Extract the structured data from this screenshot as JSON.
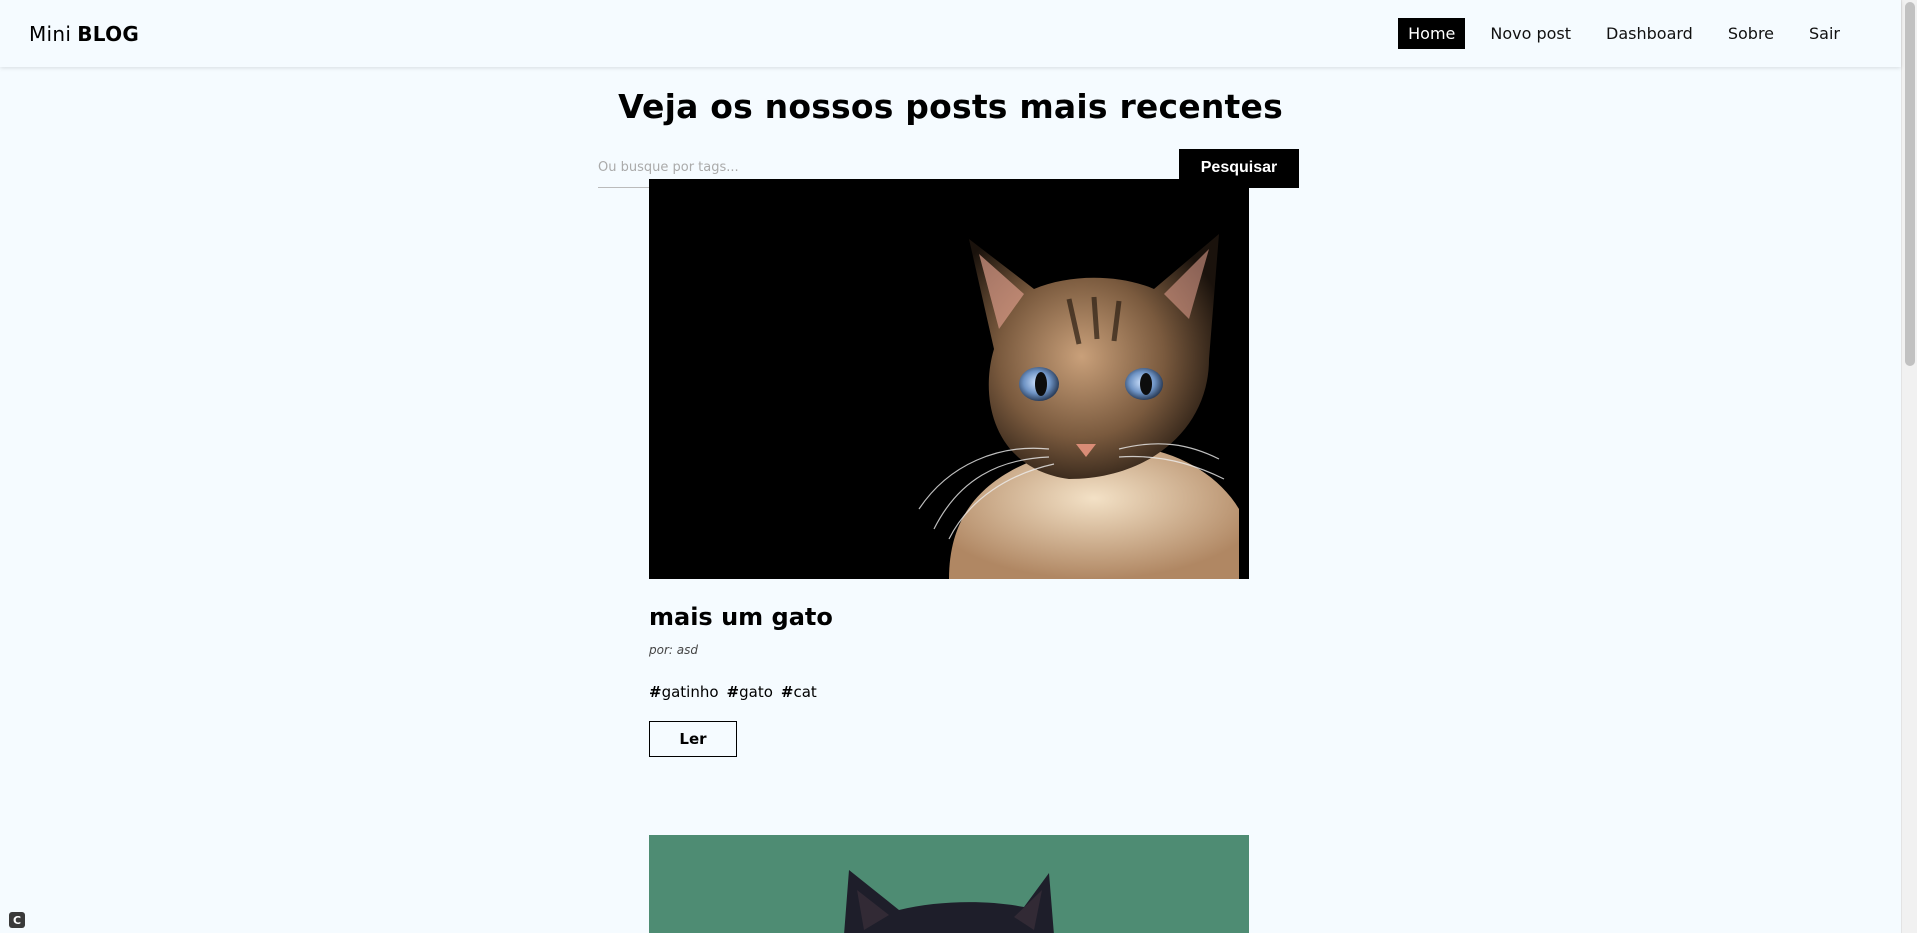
{
  "navbar": {
    "brand_light": "Mini",
    "brand_bold": "BLOG",
    "links": [
      {
        "label": "Home",
        "active": true
      },
      {
        "label": "Novo post",
        "active": false
      },
      {
        "label": "Dashboard",
        "active": false
      },
      {
        "label": "Sobre",
        "active": false
      },
      {
        "label": "Sair",
        "active": false
      }
    ]
  },
  "main": {
    "headline": "Veja os nossos posts mais recentes",
    "search": {
      "placeholder": "Ou busque por tags...",
      "value": "",
      "button_label": "Pesquisar"
    },
    "posts": [
      {
        "image_subject": "cat-photo",
        "title": "mais um gato",
        "author": "por: asd",
        "tags": [
          "gatinho",
          "gato",
          "cat"
        ],
        "read_label": "Ler"
      },
      {
        "image_subject": "cat-photo-green-background"
      }
    ]
  },
  "colors": {
    "background": "#f5fbff",
    "accent": "#000000",
    "second_image_background": "#4e8c73"
  },
  "corner_badge": "C"
}
